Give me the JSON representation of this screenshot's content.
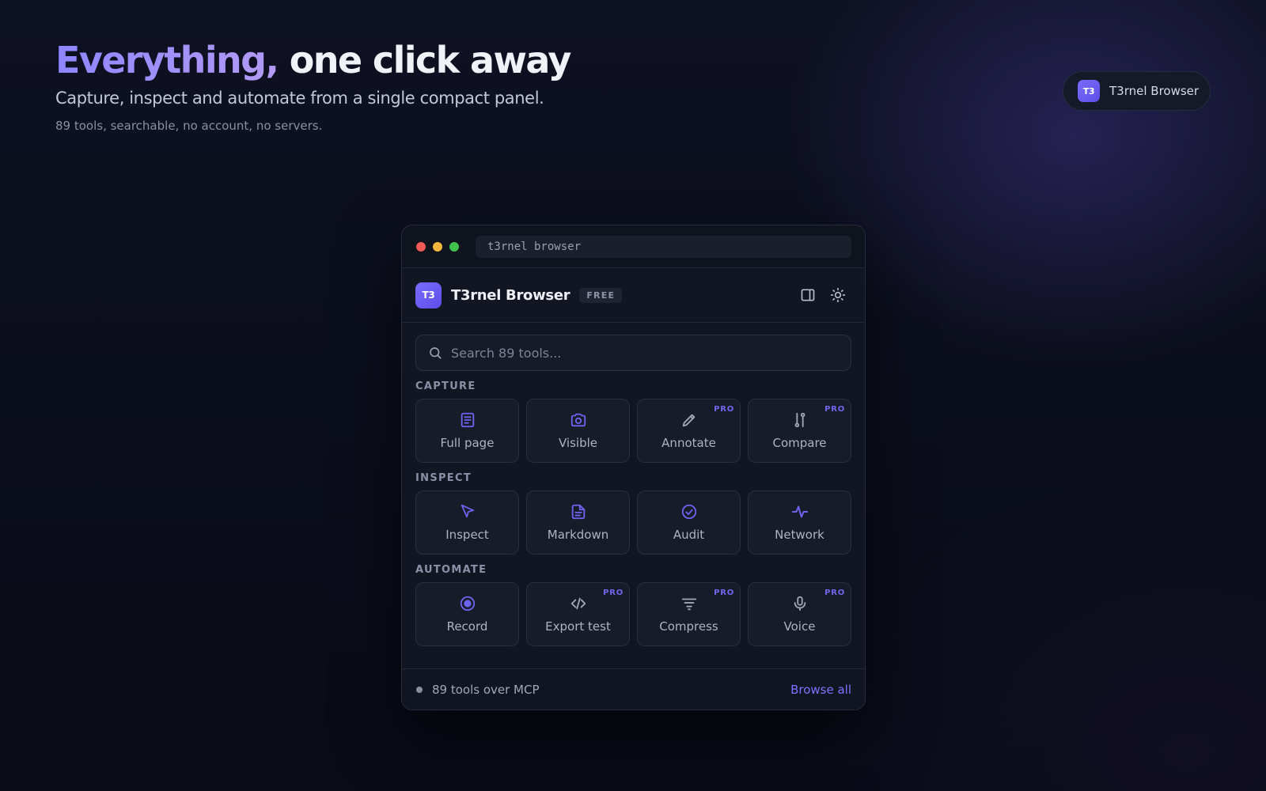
{
  "hero": {
    "title_accent": "Everything,",
    "title_rest": " one click away",
    "subtitle": "Capture, inspect and automate from a single compact panel.",
    "note": "89 tools, searchable, no account, no servers."
  },
  "brand_pill": {
    "logo": "T3",
    "label": "T3rnel Browser"
  },
  "window": {
    "address": "t3rnel browser"
  },
  "app": {
    "logo": "T3",
    "name": "T3rnel Browser",
    "badge": "FREE",
    "icons": [
      "sidebar-panel-icon",
      "sun-icon"
    ]
  },
  "search": {
    "placeholder": "Search 89 tools..."
  },
  "sections": [
    {
      "label": "CAPTURE",
      "tools": [
        {
          "label": "Full page",
          "icon": "document-icon",
          "pro": ""
        },
        {
          "label": "Visible",
          "icon": "camera-icon",
          "pro": ""
        },
        {
          "label": "Annotate",
          "icon": "pencil-icon",
          "pro": "PRO"
        },
        {
          "label": "Compare",
          "icon": "compare-icon",
          "pro": "PRO"
        }
      ]
    },
    {
      "label": "INSPECT",
      "tools": [
        {
          "label": "Inspect",
          "icon": "cursor-icon",
          "pro": ""
        },
        {
          "label": "Markdown",
          "icon": "file-text-icon",
          "pro": ""
        },
        {
          "label": "Audit",
          "icon": "check-circle-icon",
          "pro": ""
        },
        {
          "label": "Network",
          "icon": "activity-icon",
          "pro": ""
        }
      ]
    },
    {
      "label": "AUTOMATE",
      "tools": [
        {
          "label": "Record",
          "icon": "record-icon",
          "pro": ""
        },
        {
          "label": "Export test",
          "icon": "code-icon",
          "pro": "PRO"
        },
        {
          "label": "Compress",
          "icon": "filter-icon",
          "pro": "PRO"
        },
        {
          "label": "Voice",
          "icon": "microphone-icon",
          "pro": "PRO"
        }
      ]
    }
  ],
  "footer": {
    "status": "89 tools over MCP",
    "link": "Browse all"
  },
  "colors": {
    "accent": "#6e63f0",
    "pro": "#7165f0",
    "background": "#0b0e1b",
    "panel": "#121623"
  }
}
